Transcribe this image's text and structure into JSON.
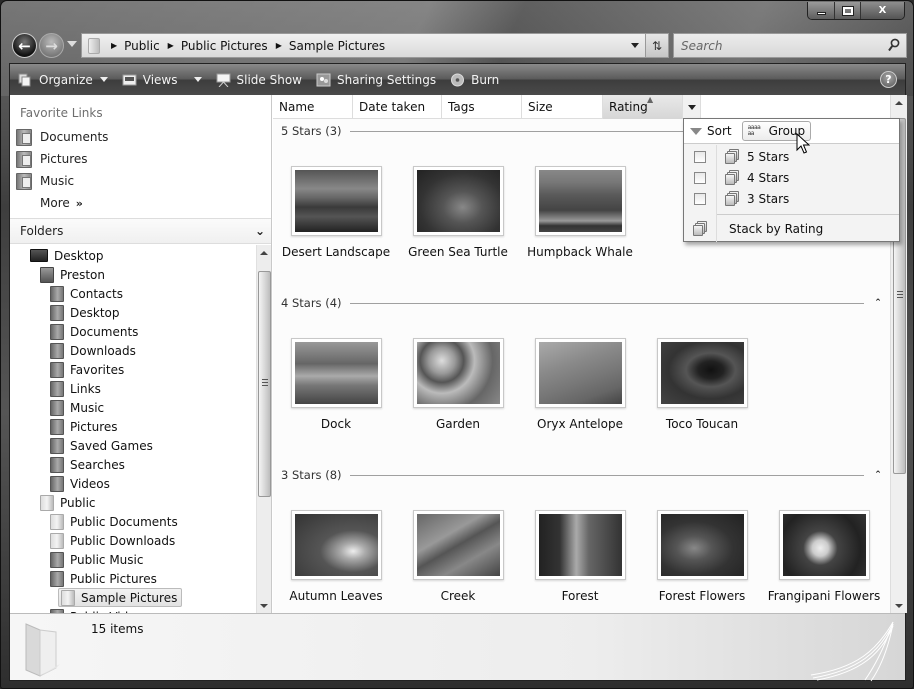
{
  "window": {
    "caption_buttons": {
      "minimize": "minimize",
      "maximize": "maximize",
      "close": "X"
    }
  },
  "address_bar": {
    "breadcrumbs": [
      "Public",
      "Public Pictures",
      "Sample Pictures"
    ]
  },
  "search": {
    "placeholder": "Search",
    "value": ""
  },
  "toolbar": {
    "organize": "Organize",
    "views": "Views",
    "slide_show": "Slide Show",
    "sharing_settings": "Sharing Settings",
    "burn": "Burn",
    "help": "?"
  },
  "nav_pane": {
    "favorite_links_title": "Favorite Links",
    "favorites": [
      {
        "label": "Documents",
        "icon": "documents-folder-icon"
      },
      {
        "label": "Pictures",
        "icon": "pictures-folder-icon"
      },
      {
        "label": "Music",
        "icon": "music-folder-icon"
      }
    ],
    "more_label": "More",
    "more_chevron": "»",
    "folders_title": "Folders",
    "folders_chevron": "⌄",
    "tree": [
      {
        "label": "Desktop",
        "level": 0,
        "icon": "desktop-icon"
      },
      {
        "label": "Preston",
        "level": 1,
        "icon": "user-folder-icon"
      },
      {
        "label": "Contacts",
        "level": 2,
        "icon": "contacts-folder-icon"
      },
      {
        "label": "Desktop",
        "level": 2,
        "icon": "folder-icon"
      },
      {
        "label": "Documents",
        "level": 2,
        "icon": "documents-folder-icon"
      },
      {
        "label": "Downloads",
        "level": 2,
        "icon": "folder-icon"
      },
      {
        "label": "Favorites",
        "level": 2,
        "icon": "favorites-folder-icon"
      },
      {
        "label": "Links",
        "level": 2,
        "icon": "folder-icon"
      },
      {
        "label": "Music",
        "level": 2,
        "icon": "music-folder-icon"
      },
      {
        "label": "Pictures",
        "level": 2,
        "icon": "pictures-folder-icon"
      },
      {
        "label": "Saved Games",
        "level": 2,
        "icon": "folder-icon"
      },
      {
        "label": "Searches",
        "level": 2,
        "icon": "searches-folder-icon"
      },
      {
        "label": "Videos",
        "level": 2,
        "icon": "videos-folder-icon"
      },
      {
        "label": "Public",
        "level": 1,
        "icon": "public-folder-icon"
      },
      {
        "label": "Public Documents",
        "level": 2,
        "icon": "public-documents-icon"
      },
      {
        "label": "Public Downloads",
        "level": 2,
        "icon": "public-downloads-icon"
      },
      {
        "label": "Public Music",
        "level": 2,
        "icon": "public-music-icon"
      },
      {
        "label": "Public Pictures",
        "level": 2,
        "icon": "public-pictures-icon"
      },
      {
        "label": "Sample Pictures",
        "level": 3,
        "icon": "folder-icon",
        "selected": true
      },
      {
        "label": "Public Videos",
        "level": 2,
        "icon": "public-videos-icon"
      }
    ]
  },
  "columns": [
    {
      "label": "Name"
    },
    {
      "label": "Date taken"
    },
    {
      "label": "Tags"
    },
    {
      "label": "Size"
    },
    {
      "label": "Rating",
      "active": true,
      "sort": "ascending"
    }
  ],
  "groups": [
    {
      "label": "5 Stars (3)",
      "items": [
        "Desert Landscape",
        "Green Sea Turtle",
        "Humpback Whale"
      ]
    },
    {
      "label": "4 Stars (4)",
      "items": [
        "Dock",
        "Garden",
        "Oryx Antelope",
        "Toco Toucan"
      ]
    },
    {
      "label": "3 Stars (8)",
      "items": [
        "Autumn Leaves",
        "Creek",
        "Forest",
        "Forest Flowers",
        "Frangipani Flowers"
      ]
    }
  ],
  "rating_menu": {
    "sort_label": "Sort",
    "group_label": "Group",
    "filters": [
      {
        "label": "5 Stars",
        "checked": false
      },
      {
        "label": "4 Stars",
        "checked": false
      },
      {
        "label": "3 Stars",
        "checked": false
      }
    ],
    "stack_label": "Stack by Rating"
  },
  "details": {
    "item_count": "15 items"
  }
}
